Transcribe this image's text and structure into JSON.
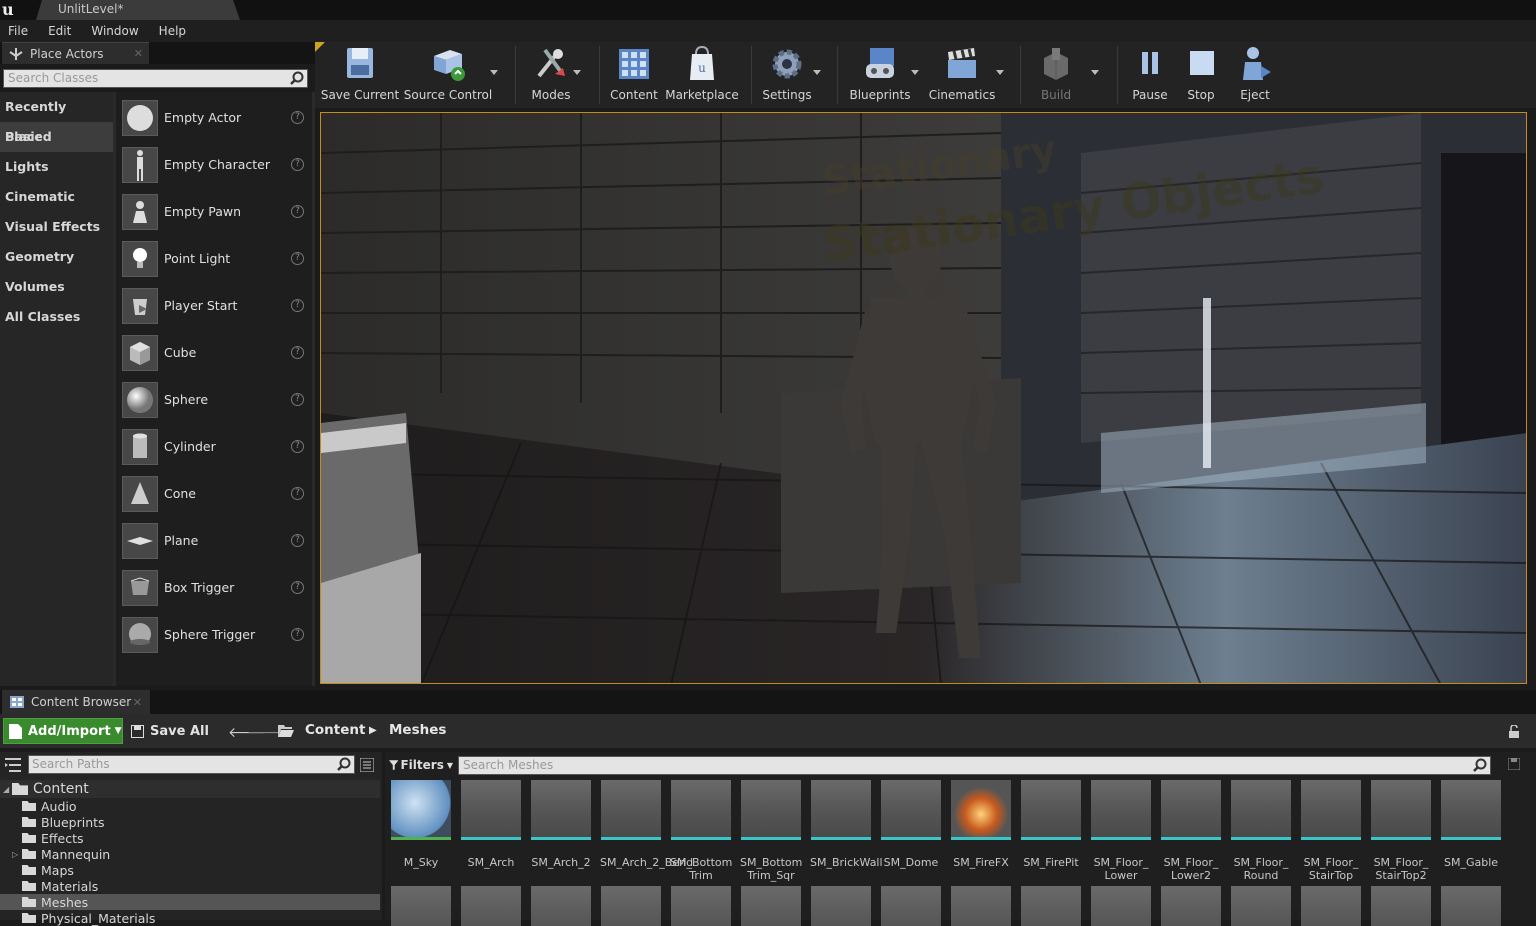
{
  "window": {
    "level_tab": "UnlitLevel*"
  },
  "menu": [
    "File",
    "Edit",
    "Window",
    "Help"
  ],
  "place_actors": {
    "tab_label": "Place Actors",
    "search_placeholder": "Search Classes",
    "categories": [
      "Recently Placed",
      "Basic",
      "Lights",
      "Cinematic",
      "Visual Effects",
      "Geometry",
      "Volumes",
      "All Classes"
    ],
    "selected_category": "Basic",
    "actors": [
      "Empty Actor",
      "Empty Character",
      "Empty Pawn",
      "Point Light",
      "Player Start",
      "Cube",
      "Sphere",
      "Cylinder",
      "Cone",
      "Plane",
      "Box Trigger",
      "Sphere Trigger"
    ]
  },
  "toolbar": {
    "save_current": "Save Current",
    "source_control": "Source Control",
    "modes": "Modes",
    "content": "Content",
    "marketplace": "Marketplace",
    "settings": "Settings",
    "blueprints": "Blueprints",
    "cinematics": "Cinematics",
    "build": "Build",
    "pause": "Pause",
    "stop": "Stop",
    "eject": "Eject"
  },
  "viewport": {
    "text_line1": "Stationary",
    "text_line2": "Stationary Objects"
  },
  "content_browser": {
    "tab_label": "Content Browser",
    "add_import": "Add/Import",
    "save_all": "Save All",
    "breadcrumb": [
      "Content",
      "Meshes"
    ],
    "search_paths_placeholder": "Search Paths",
    "filters_label": "Filters",
    "search_meshes_placeholder": "Search Meshes",
    "tree_root": "Content",
    "tree": [
      "Audio",
      "Blueprints",
      "Effects",
      "Mannequin",
      "Maps",
      "Materials",
      "Meshes",
      "Physical_Materials"
    ],
    "selected_folder": "Meshes",
    "assets": [
      "M_Sky",
      "SM_Arch",
      "SM_Arch_2",
      "SM_Arch_2_Bend",
      "SM_Bottom Trim",
      "SM_Bottom Trim_Sqr",
      "SM_BrickWall",
      "SM_Dome",
      "SM_FireFX",
      "SM_FirePit",
      "SM_Floor_ Lower",
      "SM_Floor_ Lower2",
      "SM_Floor_ Round",
      "SM_Floor_ StairTop",
      "SM_Floor_ StairTop2",
      "SM_Gable"
    ]
  }
}
